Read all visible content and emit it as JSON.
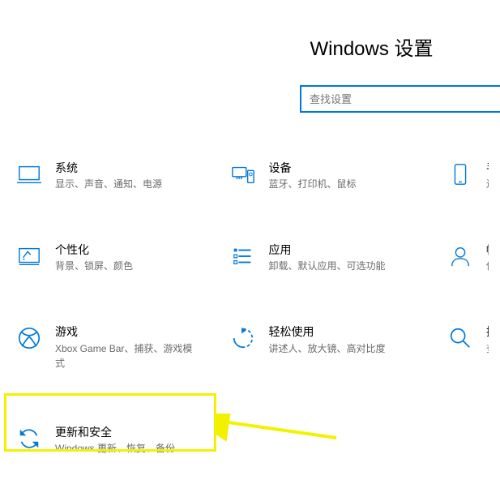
{
  "header": {
    "title": "Windows 设置"
  },
  "search": {
    "placeholder": "查找设置"
  },
  "tiles": {
    "system": {
      "title": "系统",
      "sub": "显示、声音、通知、电源"
    },
    "devices": {
      "title": "设备",
      "sub": "蓝牙、打印机、鼠标"
    },
    "phone": {
      "title": "手",
      "sub": "连"
    },
    "personalization": {
      "title": "个性化",
      "sub": "背景、锁屏、颜色"
    },
    "apps": {
      "title": "应用",
      "sub": "卸载、默认应用、可选功能"
    },
    "accounts": {
      "title": "帐",
      "sub": "你置"
    },
    "gaming": {
      "title": "游戏",
      "sub": "Xbox Game Bar、捕获、游戏模式"
    },
    "ease": {
      "title": "轻松使用",
      "sub": "讲述人、放大镜、高对比度"
    },
    "search_tile": {
      "title": "搜",
      "sub": "查"
    },
    "update": {
      "title": "更新和安全",
      "sub": "Windows 更新、恢复、备份"
    }
  },
  "colors": {
    "accent": "#0078d7"
  }
}
